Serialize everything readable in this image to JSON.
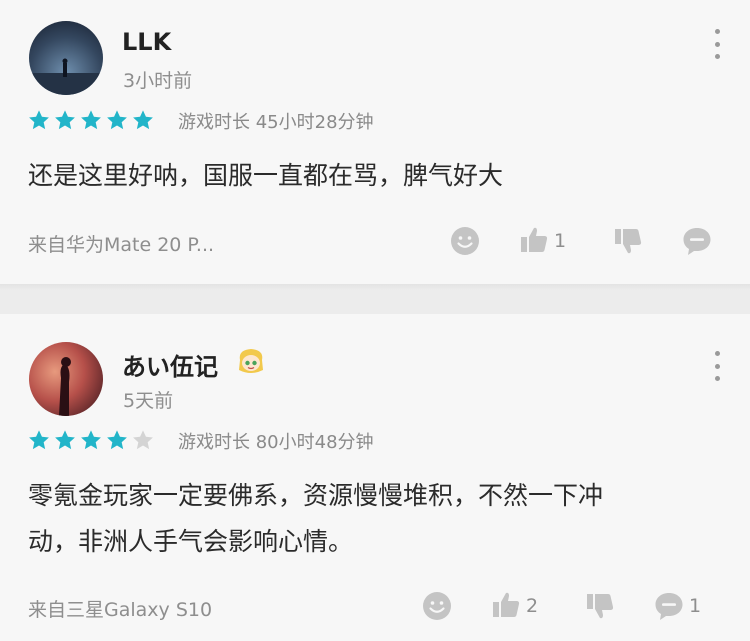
{
  "reviews": [
    {
      "username": "LLK",
      "time": "3小时前",
      "rating": 5,
      "playtime": "游戏时长 45小时28分钟",
      "content": "还是这里好呐，国服一直都在骂，脾气好大",
      "device": "来自华为Mate 20 P...",
      "likes": "1",
      "comments": ""
    },
    {
      "username": "あい伍记",
      "time": "5天前",
      "rating": 4,
      "playtime": "游戏时长 80小时48分钟",
      "content_line1": "零氪金玩家一定要佛系，资源慢慢堆积，不然一下冲",
      "content_line2": "动，非洲人手气会影响心情。",
      "device": "来自三星Galaxy S10",
      "likes": "2",
      "comments": "1"
    }
  ],
  "colors": {
    "star_on": "#22b5c9",
    "star_off": "#d4d4d4",
    "icon_gray": "#c4c4c4"
  }
}
